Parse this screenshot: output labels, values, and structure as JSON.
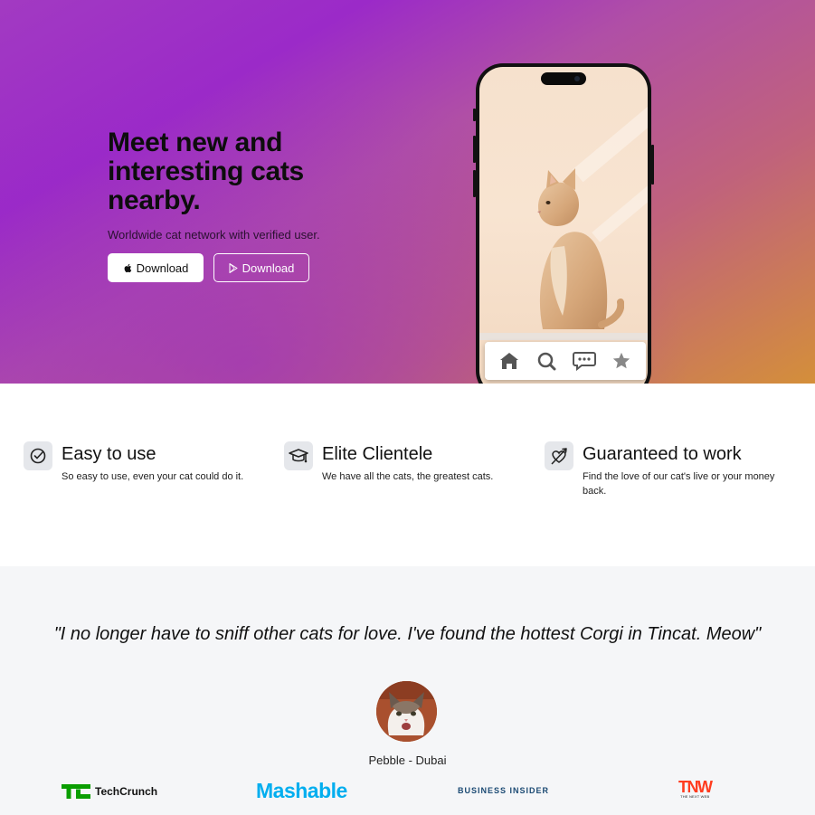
{
  "hero": {
    "title": "Meet new and interesting cats nearby.",
    "subtitle": "Worldwide cat network with verified user.",
    "buttons": [
      {
        "label": "Download",
        "icon": "apple-icon",
        "style": "solid"
      },
      {
        "label": "Download",
        "icon": "play-store-icon",
        "style": "outline"
      }
    ]
  },
  "phone": {
    "nav_icons": [
      "home-icon",
      "search-icon",
      "chat-icon",
      "star-icon"
    ]
  },
  "features": [
    {
      "icon": "check-circle-icon",
      "title": "Easy to use",
      "description": "So easy to use, even your cat could do it."
    },
    {
      "icon": "graduation-cap-icon",
      "title": "Elite Clientele",
      "description": "We have all the cats, the greatest cats."
    },
    {
      "icon": "heart-arrow-icon",
      "title": "Guaranteed to work",
      "description": "Find the love of our cat's live or your money back."
    }
  ],
  "testimonial": {
    "quote": "\"I no longer have to sniff other cats for love. I've found the hottest Corgi in Tincat. Meow\"",
    "author": "Pebble - Dubai"
  },
  "press": {
    "techcrunch": "TechCrunch",
    "mashable": "Mashable",
    "business_insider": "BUSINESS INSIDER",
    "tnw": "TNW",
    "tnw_sub": "THE NEXT WEB"
  },
  "colors": {
    "hero_gradient_start": "#9b2ac8",
    "hero_gradient_end": "#d48f3a",
    "techcrunch_green": "#0a9e01",
    "mashable_blue": "#00aeef",
    "business_insider_blue": "#1b4a73",
    "tnw_red": "#ff3c1f"
  }
}
